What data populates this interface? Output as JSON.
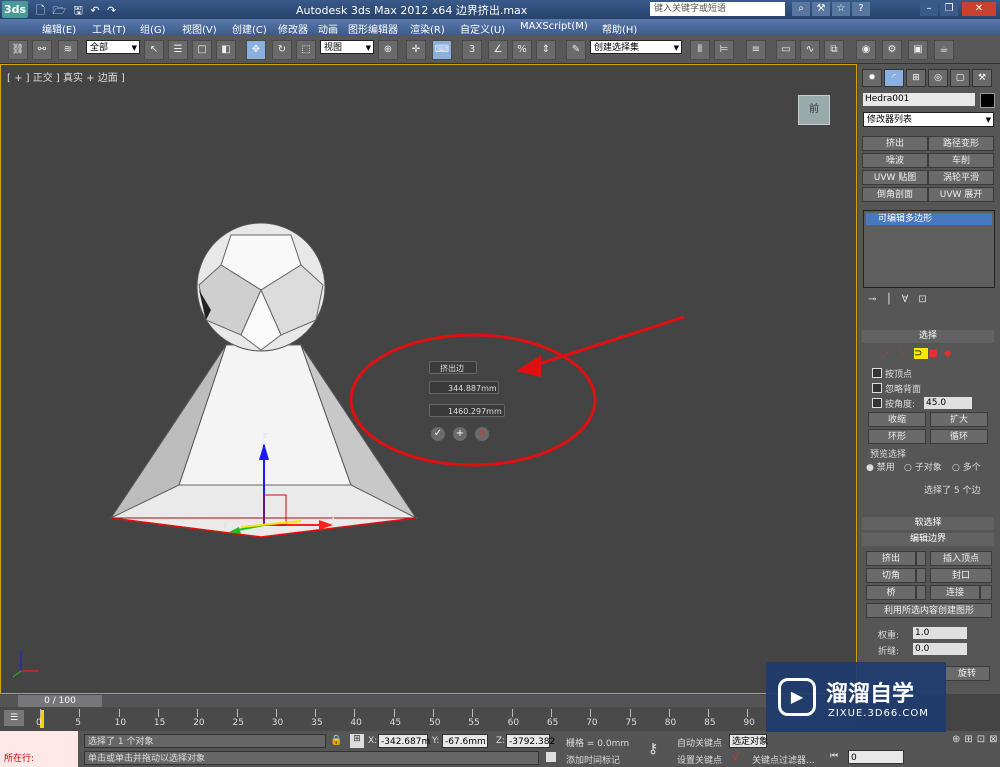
{
  "window": {
    "title": "Autodesk 3ds Max  2012 x64      边界挤出.max",
    "logo": "3ds",
    "search_placeholder": "键入关键字或短语"
  },
  "menu": [
    "编辑(E)",
    "工具(T)",
    "组(G)",
    "视图(V)",
    "创建(C)",
    "修改器",
    "动画",
    "图形编辑器",
    "渲染(R)",
    "自定义(U)",
    "MAXScript(M)",
    "帮助(H)"
  ],
  "toolbar": {
    "selection_filter": "全部",
    "reference_coord": "视图",
    "named_selection": "创建选择集",
    "snap_label": "3"
  },
  "viewport": {
    "label": "[ + ] 正交 ] 真实 + 边面 ]",
    "viewcube_label": "前",
    "caddy": {
      "title": "挤出边",
      "height_value": "344.887mm",
      "width_value": "1460.297mm"
    },
    "gizmo_axes": [
      "z",
      "y",
      "x"
    ]
  },
  "command_panel": {
    "object_name": "Hedra001",
    "modifier_list": "修改器列表",
    "modifier_buttons": [
      "挤出",
      "路径变形",
      "噪波",
      "车削",
      "UVW 贴图",
      "涡轮平滑",
      "倒角剖面",
      "UVW 展开"
    ],
    "stack_item": "可编辑多边形",
    "selection_rollout": "选择",
    "by_vertex": "按顶点",
    "ignore_backfacing": "忽略背面",
    "by_angle": "按角度:",
    "angle_value": "45.0",
    "shrink": "收缩",
    "grow": "扩大",
    "ring": "环形",
    "loop": "循环",
    "preview_selection": "预览选择",
    "preview_options": [
      "禁用",
      "子对象",
      "多个"
    ],
    "selection_info": "选择了 5 个边",
    "soft_selection": "软选择",
    "edit_edges": "编辑边界",
    "extrude": "挤出",
    "insert_vertex": "插入顶点",
    "chamfer": "切角",
    "cap": "封口",
    "bridge": "桥",
    "connect": "连接",
    "create_shape": "利用所选内容创建图形",
    "weight_label": "权重:",
    "weight_value": "1.0",
    "crease_label": "折缝:",
    "crease_value": "0.0",
    "rotate": "旋转"
  },
  "timeline": {
    "frame": "0 / 100",
    "ticks": [
      "0",
      "5",
      "10",
      "15",
      "20",
      "25",
      "30",
      "35",
      "40",
      "45",
      "50",
      "55",
      "60",
      "65",
      "70",
      "75",
      "80",
      "85",
      "90"
    ]
  },
  "status": {
    "in_progress": "所在行:",
    "selected": "选择了 1 个对象",
    "prompt": "单击或单击并拖动以选择对象",
    "x_label": "X:",
    "x_value": "-342.687m",
    "y_label": "Y:",
    "y_value": "-67.6mm",
    "z_label": "Z:",
    "z_value": "-3792.382",
    "grid": "栅格 = 0.0mm",
    "add_time_tag": "添加时间标记",
    "auto_key": "自动关键点",
    "selected_set": "选定对象",
    "set_key": "设置关键点",
    "key_filters": "关键点过滤器...",
    "frame_input": "0"
  },
  "watermark": {
    "brand": "溜溜自学",
    "url": "ZIXUE.3D66.COM"
  },
  "colors": {
    "accent_yellow": "#d8a300",
    "annotation_red": "#e01010",
    "title_blue": "#3a5a8a"
  }
}
